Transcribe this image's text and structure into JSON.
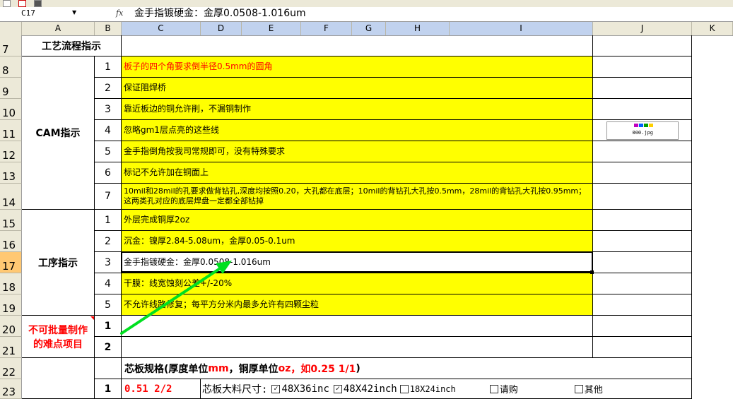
{
  "formula_bar": {
    "name_box": "C17",
    "fx_label": "fx",
    "content": "金手指镀硬金：金厚0.0508-1.016um"
  },
  "columns": [
    "A",
    "B",
    "C",
    "D",
    "E",
    "F",
    "G",
    "H",
    "I",
    "J",
    "K"
  ],
  "rows": [
    "7",
    "8",
    "9",
    "10",
    "11",
    "12",
    "13",
    "14",
    "15",
    "16",
    "17",
    "18",
    "19",
    "20",
    "21",
    "22",
    "23"
  ],
  "process_title": "工艺流程指示",
  "cam": {
    "label": "CAM指示",
    "items": [
      {
        "num": "1",
        "text": "板子的四个角要求倒半径0.5mm的圆角"
      },
      {
        "num": "2",
        "text": "保证阻焊桥"
      },
      {
        "num": "3",
        "text": "靠近板边的铜允许削，不漏铜制作"
      },
      {
        "num": "4",
        "text": "忽略gm1层点亮的这些线"
      },
      {
        "num": "5",
        "text": "金手指倒角按我司常规即可，没有特殊要求"
      },
      {
        "num": "6",
        "text": "标记不允许加在铜面上"
      },
      {
        "num": "7",
        "text": "10mil和28mil的孔要求做背钻孔,深度均按照0.20，大孔都在底层；10mil的背钻孔大孔按0.5mm，28mil的背钻孔大孔按0.95mm；这两类孔对应的底层焊盘一定都全部钻掉"
      }
    ]
  },
  "embedded_image_caption": "000.jpg",
  "process": {
    "label": "工序指示",
    "items": [
      {
        "num": "1",
        "text": "外层完成铜厚2oz"
      },
      {
        "num": "2",
        "text": "沉金：镍厚2.84-5.08um，金厚0.05-0.1um"
      },
      {
        "num": "3",
        "text": "金手指镀硬金：金厚0.0508-1.016um"
      },
      {
        "num": "4",
        "text": "干膜：线宽蚀刻公差+/-20%"
      },
      {
        "num": "5",
        "text": "不允许线路修复；每平方分米内最多允许有四颗尘粒"
      }
    ]
  },
  "difficult": {
    "label_line1": "不可批量制作",
    "label_line2": "的难点项目",
    "items": [
      {
        "num": "1"
      },
      {
        "num": "2"
      }
    ]
  },
  "core_spec": {
    "title_a": "芯板规格(厚度单位",
    "title_b": "mm",
    "title_c": "，铜厚单位",
    "title_d": "oz",
    "title_e": "，如0.25 1/1",
    "title_f": ")",
    "row_num": "1",
    "value": "0.51 2/2",
    "size_label": "芯板大料尺寸:",
    "opt1": "48X36inc",
    "opt2": "48X42inch",
    "opt3": "18X24inch",
    "opt4": "请购",
    "opt5": "其他",
    "check_mark": "✓"
  },
  "colors": {
    "highlight": "#ffff00",
    "red_text": "#ff0000",
    "arrow": "#00e020",
    "header_bg": "#ece9d8",
    "selected_row_header": "#ffc873"
  }
}
